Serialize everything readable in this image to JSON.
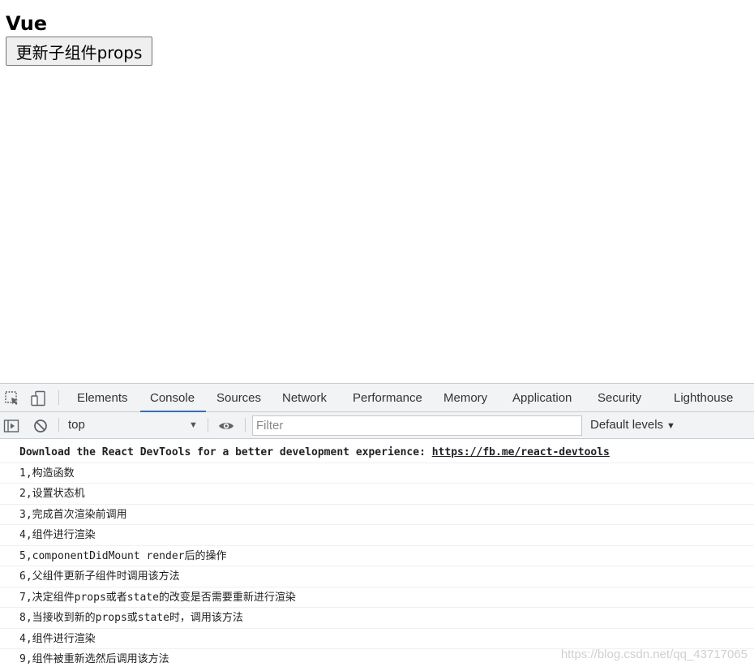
{
  "app": {
    "title": "Vue",
    "button_label": "更新子组件props"
  },
  "devtools": {
    "tabs": [
      {
        "label": "Elements",
        "active": false
      },
      {
        "label": "Console",
        "active": true
      },
      {
        "label": "Sources",
        "active": false
      },
      {
        "label": "Network",
        "active": false
      },
      {
        "label": "Performance",
        "active": false
      },
      {
        "label": "Memory",
        "active": false
      },
      {
        "label": "Application",
        "active": false
      },
      {
        "label": "Security",
        "active": false
      },
      {
        "label": "Lighthouse",
        "active": false
      }
    ],
    "toolbar_icons": [
      "inspect-element-icon",
      "device-toolbar-icon"
    ],
    "filter_icons": [
      "sidebar-toggle-icon",
      "clear-console-icon",
      "live-expression-eye-icon"
    ],
    "context": "top",
    "filter_placeholder": "Filter",
    "levels_label": "Default levels",
    "accent_color": "#1a73e8",
    "console_messages": {
      "devtools_prefix": "Download the React DevTools for a better development experience: ",
      "devtools_link": "https://fb.me/react-devtools",
      "lines": [
        "1,构造函数",
        "2,设置状态机",
        "3,完成首次渲染前调用",
        "4,组件进行渲染",
        "5,componentDidMount render后的操作",
        "6,父组件更新子组件时调用该方法",
        "7,决定组件props或者state的改变是否需要重新进行渲染",
        "8,当接收到新的props或state时，调用该方法",
        "4,组件进行渲染",
        "9,组件被重新选然后调用该方法"
      ]
    }
  },
  "watermark": "https://blog.csdn.net/qq_43717065"
}
